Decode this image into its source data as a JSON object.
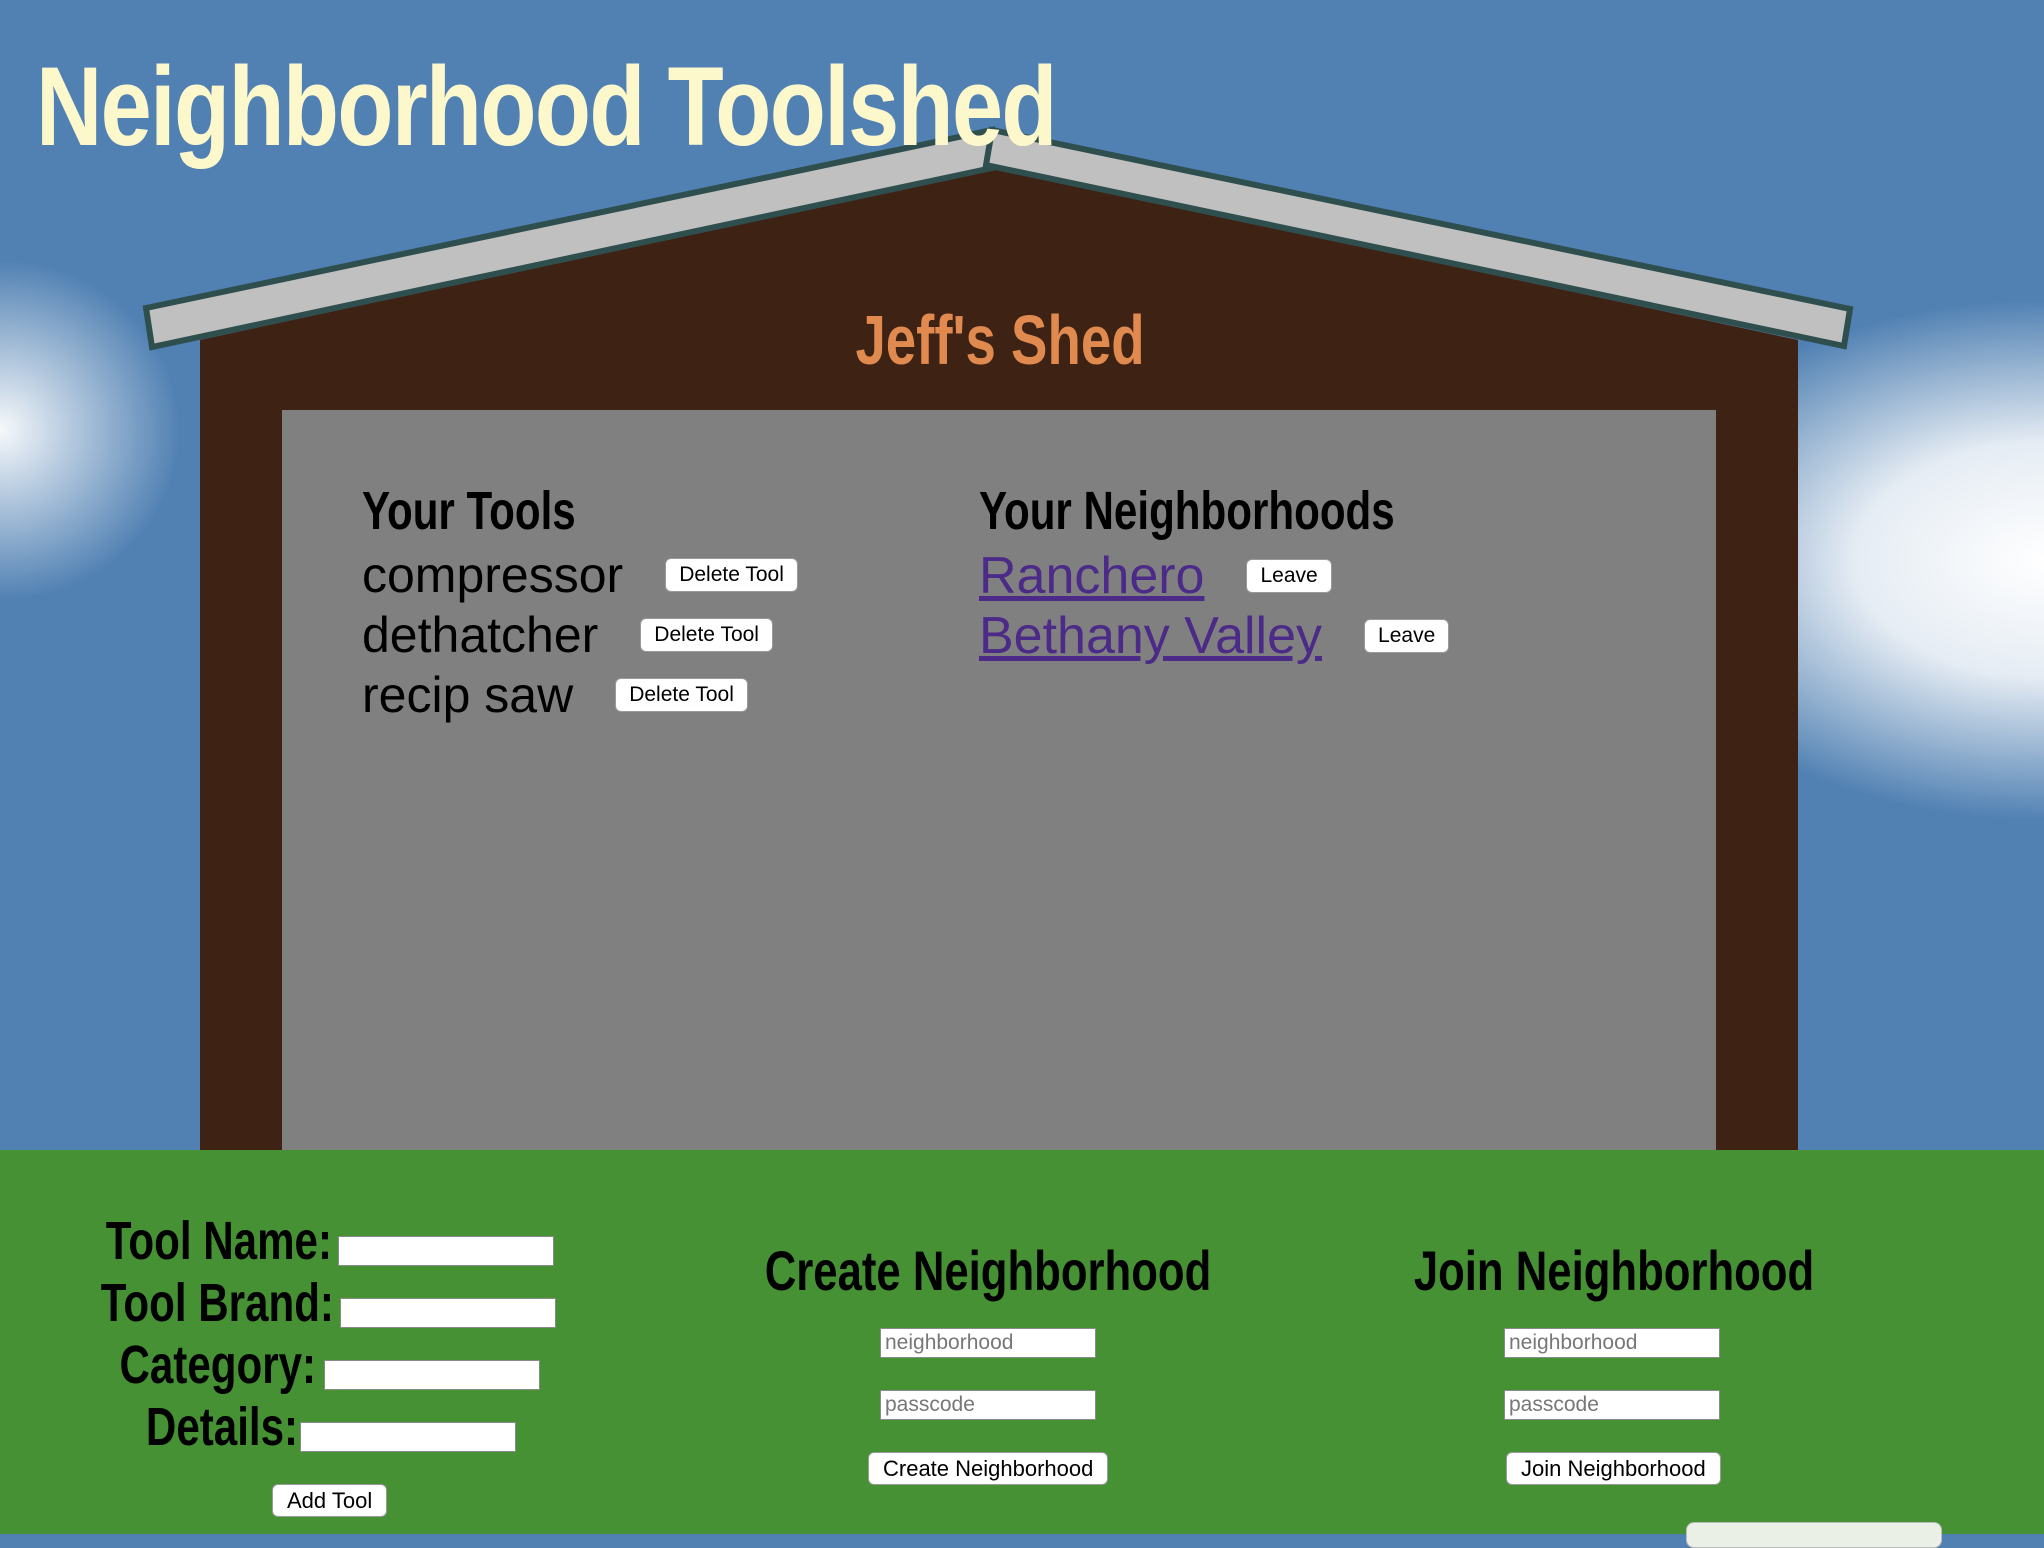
{
  "site": {
    "title": "Neighborhood Toolshed"
  },
  "shed": {
    "name": "Jeff's Shed"
  },
  "tools": {
    "heading": "Your Tools",
    "delete_label": "Delete Tool",
    "items": [
      "compressor",
      "dethatcher",
      "recip saw"
    ]
  },
  "neighborhoods": {
    "heading": "Your Neighborhoods",
    "leave_label": "Leave",
    "items": [
      "Ranchero",
      "Bethany Valley"
    ]
  },
  "add_tool_form": {
    "name_label": "Tool Name:",
    "brand_label": "Tool Brand:",
    "category_label": "Category:",
    "details_label": "Details:",
    "submit_label": "Add Tool"
  },
  "create_form": {
    "heading": "Create Neighborhood",
    "neighborhood_placeholder": "neighborhood",
    "passcode_placeholder": "passcode",
    "submit_label": "Create Neighborhood"
  },
  "join_form": {
    "heading": "Join Neighborhood",
    "neighborhood_placeholder": "neighborhood",
    "passcode_placeholder": "passcode",
    "submit_label": "Join Neighborhood"
  },
  "colors": {
    "sky": "#5181b3",
    "title": "#fdf8cc",
    "shed_wall": "#3e2213",
    "shed_name": "#e08a50",
    "door": "#808080",
    "roof": "#c0c0c0",
    "roof_edge": "#2f4f4f",
    "grass": "#469134",
    "link": "#4b2a88"
  }
}
